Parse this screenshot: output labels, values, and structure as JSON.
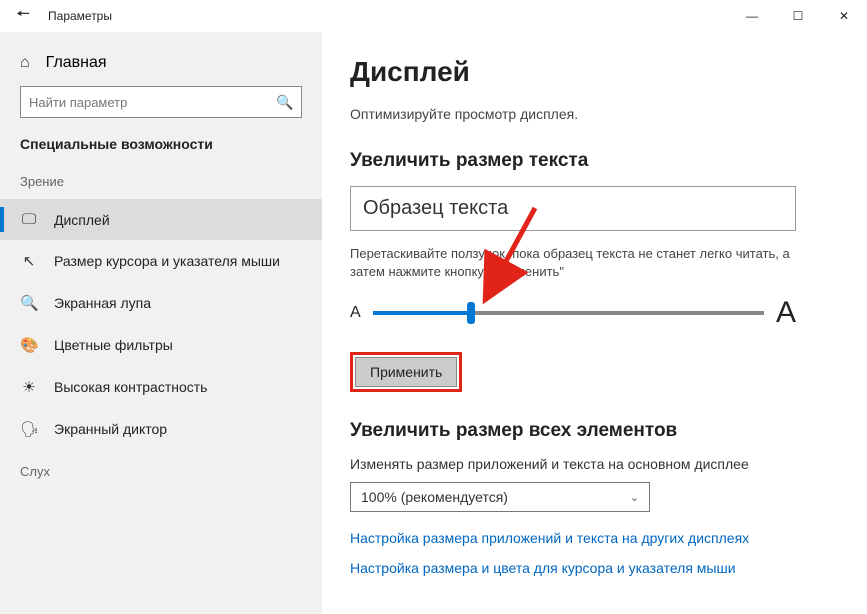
{
  "titlebar": {
    "title": "Параметры"
  },
  "sidebar": {
    "home": "Главная",
    "search_placeholder": "Найти параметр",
    "header": "Специальные возможности",
    "vision": "Зрение",
    "items": [
      {
        "label": "Дисплей"
      },
      {
        "label": "Размер курсора и указателя мыши"
      },
      {
        "label": "Экранная лупа"
      },
      {
        "label": "Цветные фильтры"
      },
      {
        "label": "Высокая контрастность"
      },
      {
        "label": "Экранный диктор"
      }
    ],
    "hearing": "Слух"
  },
  "content": {
    "title": "Дисплей",
    "subtitle": "Оптимизируйте просмотр дисплея.",
    "text_size_header": "Увеличить размер текста",
    "sample_text": "Образец текста",
    "slider_help": "Перетаскивайте ползунок, пока образец текста не станет легко читать, а затем нажмите кнопку \"Применить\"",
    "a_small": "A",
    "a_big": "A",
    "apply": "Применить",
    "all_elements_header": "Увеличить размер всех элементов",
    "dropdown_label": "Изменять размер приложений и текста на основном дисплее",
    "dropdown_value": "100% (рекомендуется)",
    "link1": "Настройка размера приложений и текста на других дисплеях",
    "link2": "Настройка размера и цвета для курсора и указателя мыши"
  }
}
